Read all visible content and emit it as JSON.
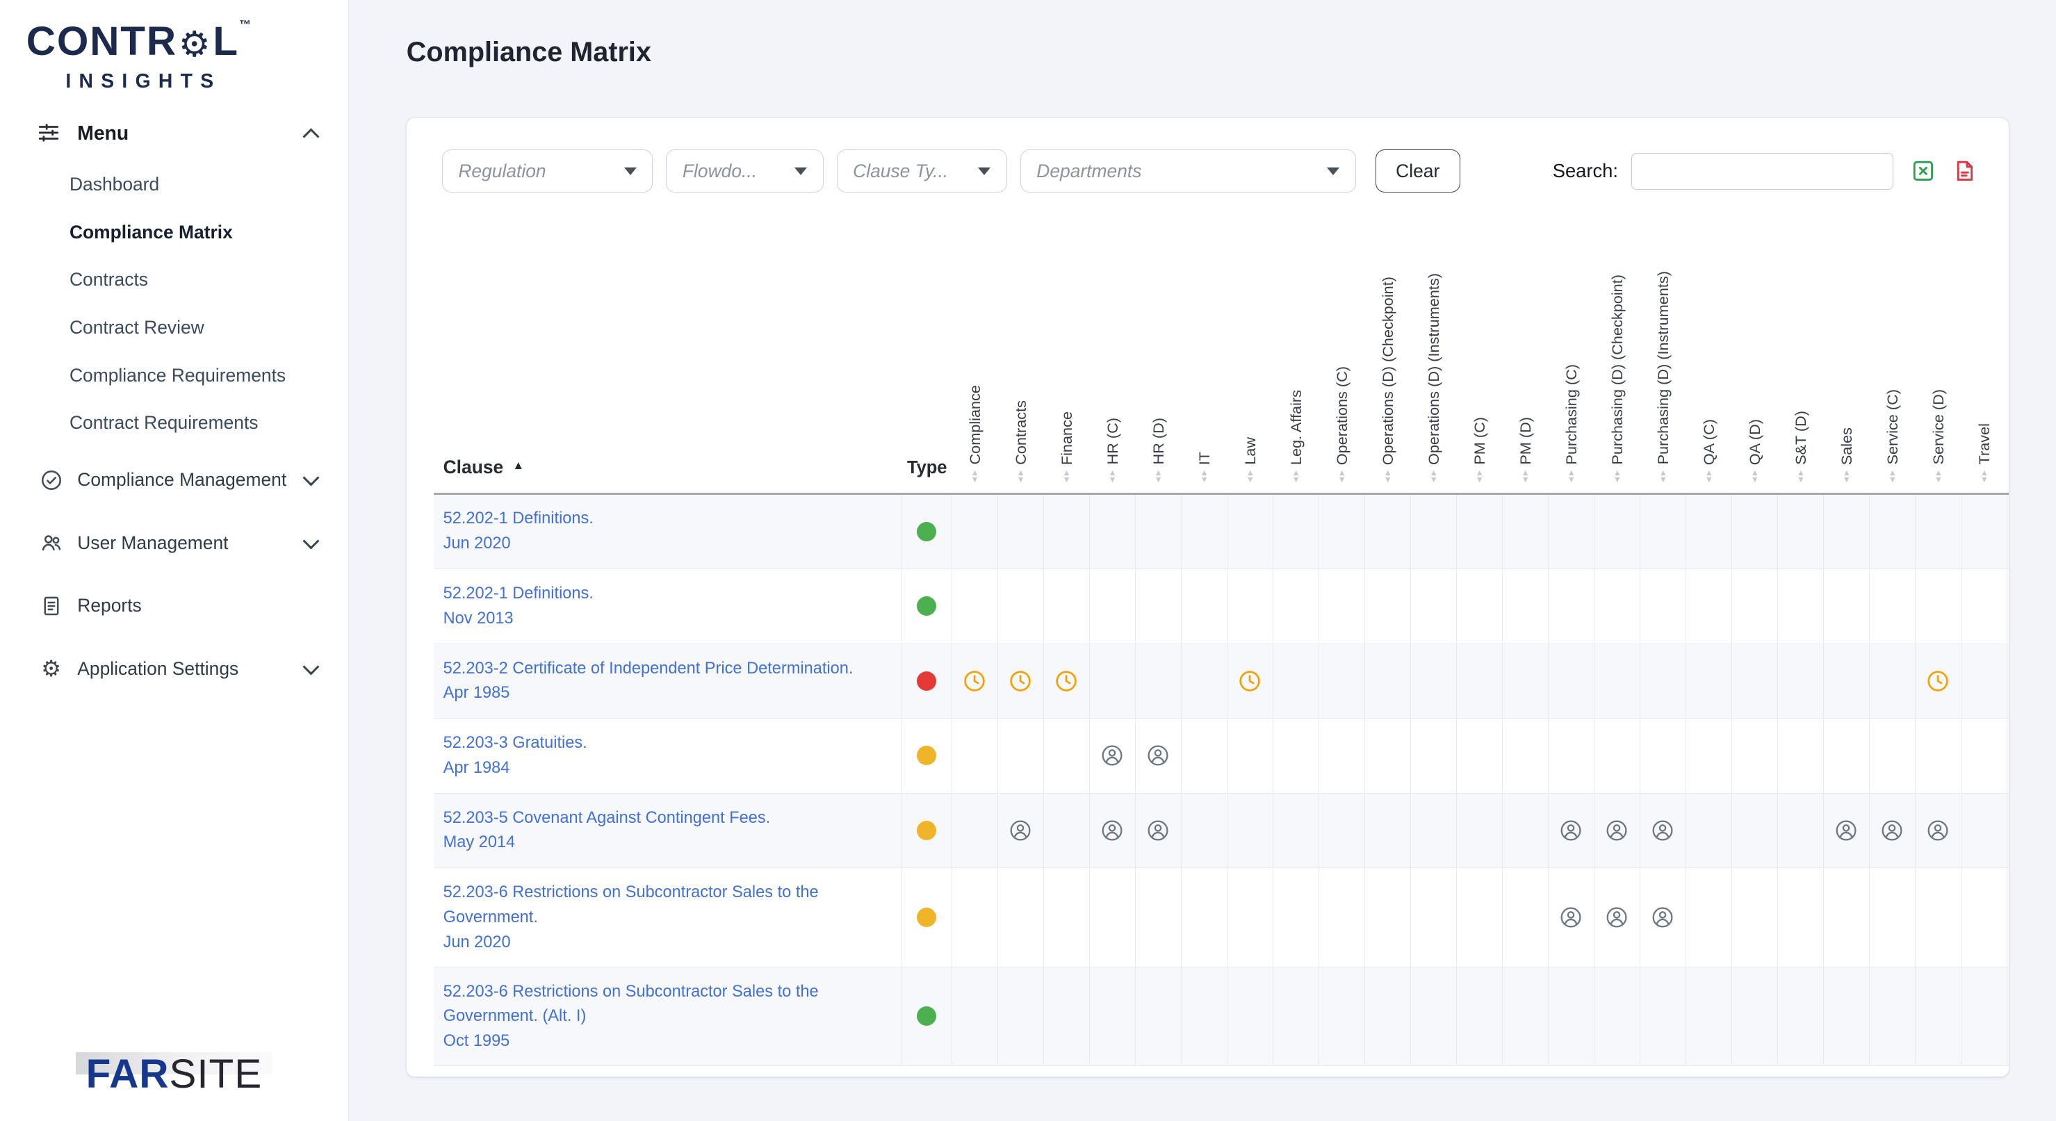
{
  "sidebar": {
    "logo": {
      "part1": "CONTR",
      "gear_glyph": "⚙",
      "part2": "L",
      "trademark": "™",
      "subtitle": "INSIGHTS"
    },
    "menu_label": "Menu",
    "items": [
      {
        "label": "Dashboard",
        "active": false
      },
      {
        "label": "Compliance Matrix",
        "active": true
      },
      {
        "label": "Contracts",
        "active": false
      },
      {
        "label": "Contract Review",
        "active": false
      },
      {
        "label": "Compliance Requirements",
        "active": false
      },
      {
        "label": "Contract Requirements",
        "active": false
      }
    ],
    "sections": [
      {
        "label": "Compliance Management",
        "icon": "check-circle",
        "expandable": true
      },
      {
        "label": "User Management",
        "icon": "users",
        "expandable": true
      },
      {
        "label": "Reports",
        "icon": "document",
        "expandable": false
      },
      {
        "label": "Application Settings",
        "icon": "gear",
        "expandable": true
      }
    ],
    "footer_logo": {
      "far": "FAR",
      "site": "SITE"
    }
  },
  "header": {
    "title": "Compliance Matrix"
  },
  "filters": {
    "selects": [
      "Regulation",
      "Flowdo...",
      "Clause Ty...",
      "Departments"
    ],
    "clear_label": "Clear",
    "search_label": "Search:",
    "search_value": ""
  },
  "table": {
    "clause_header": "Clause",
    "type_header": "Type",
    "sort": {
      "column": "Clause",
      "direction": "asc"
    },
    "glyphs": {
      "asc": "▲",
      "up": "▲",
      "down": "▼"
    },
    "departments": [
      "Compliance",
      "Contracts",
      "Finance",
      "HR (C)",
      "HR (D)",
      "IT",
      "Law",
      "Leg. Affairs",
      "Operations (C)",
      "Operations (D) (Checkpoint)",
      "Operations (D) (Instruments)",
      "PM (C)",
      "PM (D)",
      "Purchasing (C)",
      "Purchasing (D) (Checkpoint)",
      "Purchasing (D) (Instruments)",
      "QA (C)",
      "QA (D)",
      "S&T (D)",
      "Sales",
      "Service (C)",
      "Service (D)",
      "Travel"
    ],
    "type_colors": {
      "green": "#4caf50",
      "red": "#e53935",
      "yellow": "#f0b429"
    },
    "icons": {
      "clock": {
        "name": "clock-icon",
        "color": "#f59f00"
      },
      "person": {
        "name": "person-icon",
        "color": "#6d757e"
      }
    },
    "rows": [
      {
        "clause": "52.202-1 Definitions.",
        "date": "Jun 2020",
        "type": "green",
        "cells": {}
      },
      {
        "clause": "52.202-1 Definitions.",
        "date": "Nov 2013",
        "type": "green",
        "cells": {}
      },
      {
        "clause": "52.203-2 Certificate of Independent Price Determination.",
        "date": "Apr 1985",
        "type": "red",
        "cells": {
          "Compliance": "clock",
          "Contracts": "clock",
          "Finance": "clock",
          "Law": "clock",
          "Service (D)": "clock"
        }
      },
      {
        "clause": "52.203-3 Gratuities.",
        "date": "Apr 1984",
        "type": "yellow",
        "cells": {
          "HR (C)": "person",
          "HR (D)": "person"
        }
      },
      {
        "clause": "52.203-5 Covenant Against Contingent Fees.",
        "date": "May 2014",
        "type": "yellow",
        "cells": {
          "Contracts": "person",
          "HR (C)": "person",
          "HR (D)": "person",
          "Purchasing (C)": "person",
          "Purchasing (D) (Checkpoint)": "person",
          "Purchasing (D) (Instruments)": "person",
          "Sales": "person",
          "Service (C)": "person",
          "Service (D)": "person"
        }
      },
      {
        "clause": "52.203-6 Restrictions on Subcontractor Sales to the Government.",
        "date": "Jun 2020",
        "type": "yellow",
        "cells": {
          "Purchasing (C)": "person",
          "Purchasing (D) (Checkpoint)": "person",
          "Purchasing (D) (Instruments)": "person"
        }
      },
      {
        "clause": "52.203-6 Restrictions on Subcontractor Sales to the Government. (Alt. I)",
        "date": "Oct 1995",
        "type": "green",
        "cells": {}
      }
    ]
  }
}
